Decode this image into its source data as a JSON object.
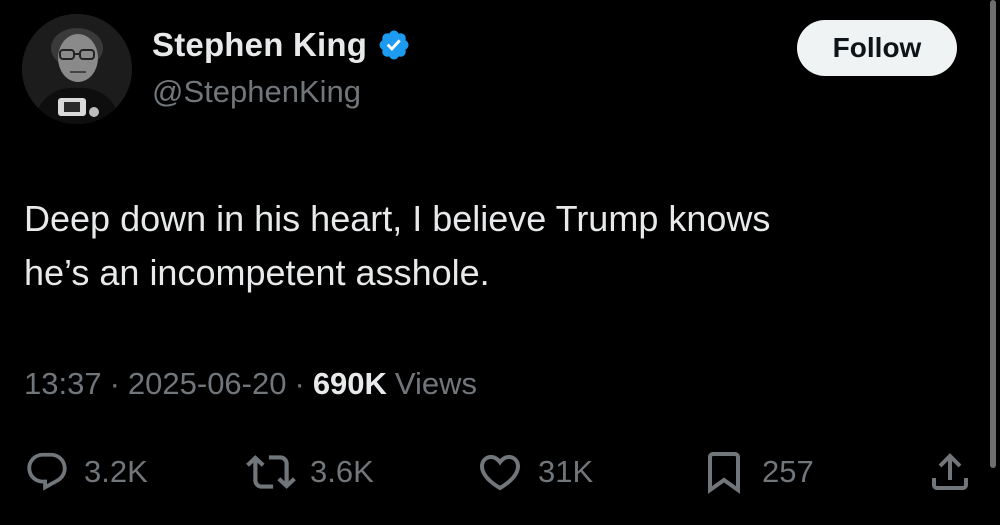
{
  "author": {
    "display_name": "Stephen King",
    "handle": "@StephenKing",
    "verified": true,
    "verified_color": "#1d9bf0",
    "avatar_icon": "user-avatar-photo"
  },
  "follow_button": {
    "label": "Follow"
  },
  "tweet": {
    "text": "Deep down in his heart, I believe Trump knows\nhe’s an incompetent asshole.",
    "time": "13:37",
    "date": "2025-06-20",
    "separator": "·",
    "views_count": "690K",
    "views_label": "Views"
  },
  "actions": {
    "reply": {
      "icon": "reply-icon",
      "count": "3.2K"
    },
    "retweet": {
      "icon": "retweet-icon",
      "count": "3.6K"
    },
    "like": {
      "icon": "heart-icon",
      "count": "31K"
    },
    "bookmark": {
      "icon": "bookmark-icon",
      "count": "257"
    },
    "share": {
      "icon": "share-icon"
    }
  },
  "colors": {
    "background": "#000000",
    "primary_text": "#e7e9ea",
    "secondary_text": "#71767b",
    "button_bg": "#eff3f4",
    "button_text": "#0f1419"
  }
}
